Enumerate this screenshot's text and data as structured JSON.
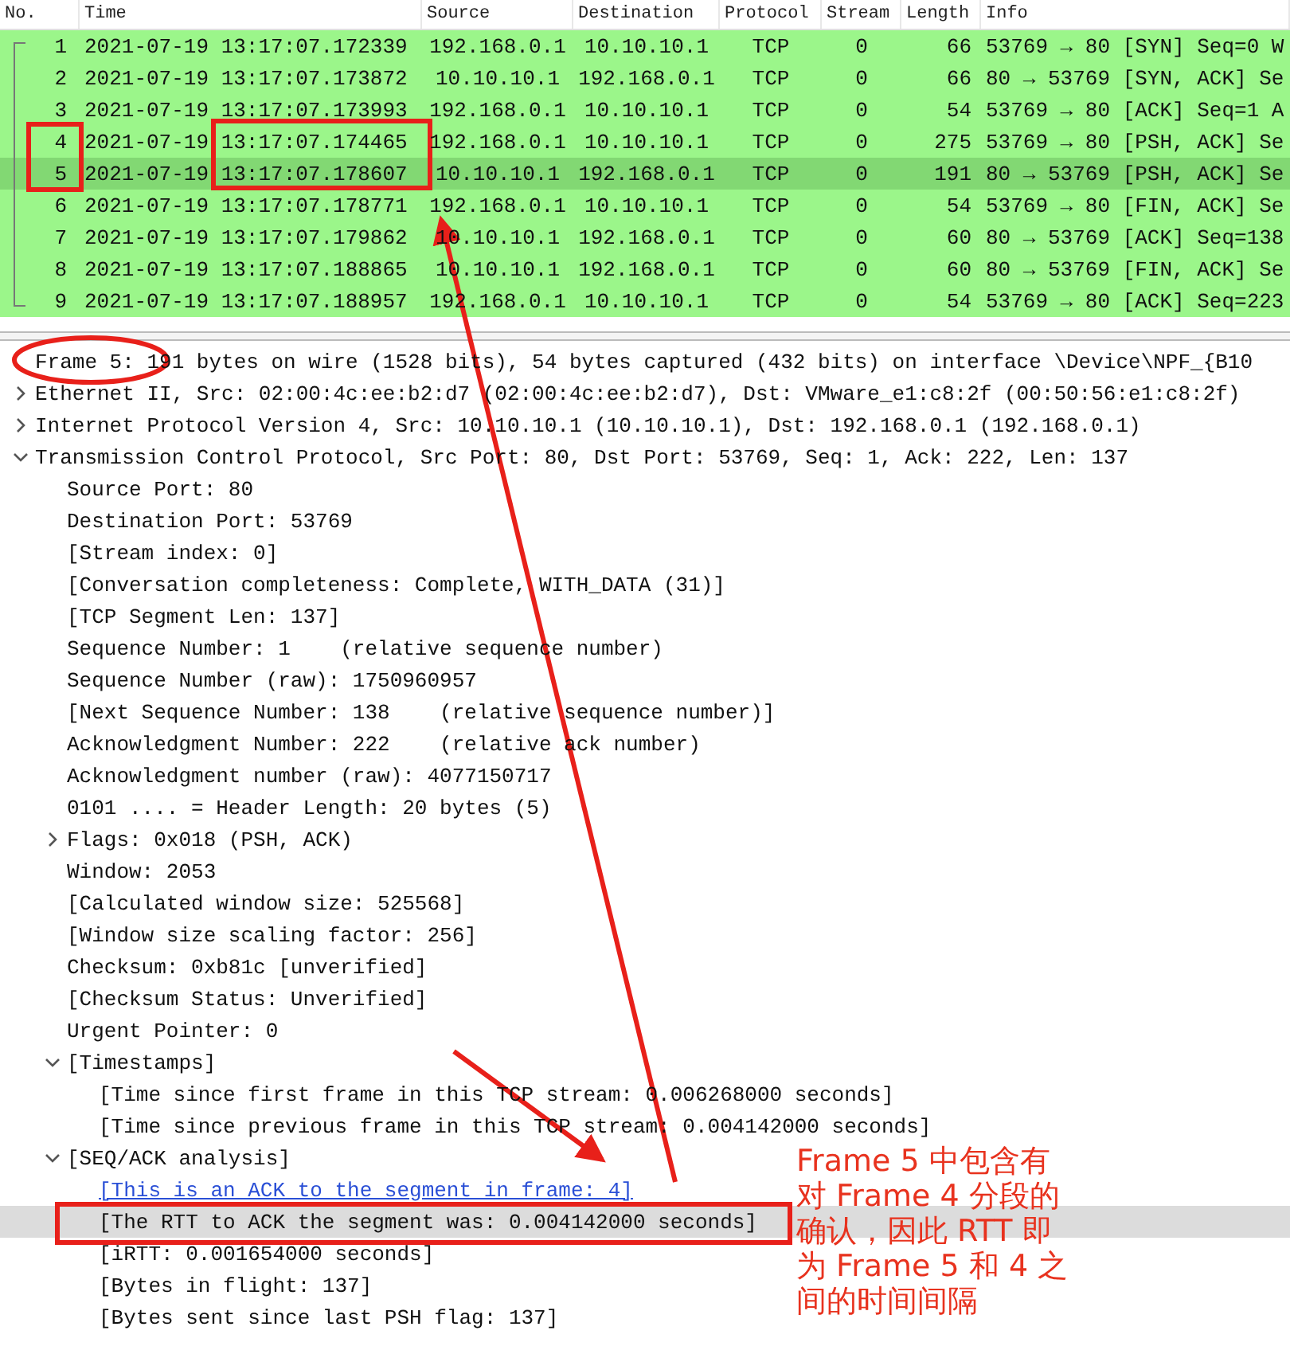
{
  "packet_list": {
    "columns": [
      "No.",
      "Time",
      "Source",
      "Destination",
      "Protocol",
      "Stream",
      "Length",
      "Info"
    ],
    "rows": [
      {
        "cells": [
          "1",
          "2021-07-19 13:17:07.172339",
          "192.168.0.1",
          "10.10.10.1",
          "TCP",
          "0",
          "66",
          "53769 → 80 [SYN] Seq=0 W"
        ],
        "selected": false
      },
      {
        "cells": [
          "2",
          "2021-07-19 13:17:07.173872",
          "10.10.10.1",
          "192.168.0.1",
          "TCP",
          "0",
          "66",
          "80 → 53769 [SYN, ACK] Se"
        ],
        "selected": false
      },
      {
        "cells": [
          "3",
          "2021-07-19 13:17:07.173993",
          "192.168.0.1",
          "10.10.10.1",
          "TCP",
          "0",
          "54",
          "53769 → 80 [ACK] Seq=1 A"
        ],
        "selected": false
      },
      {
        "cells": [
          "4",
          "2021-07-19 13:17:07.174465",
          "192.168.0.1",
          "10.10.10.1",
          "TCP",
          "0",
          "275",
          "53769 → 80 [PSH, ACK] Se"
        ],
        "selected": false
      },
      {
        "cells": [
          "5",
          "2021-07-19 13:17:07.178607",
          "10.10.10.1",
          "192.168.0.1",
          "TCP",
          "0",
          "191",
          "80 → 53769 [PSH, ACK] Se"
        ],
        "selected": true
      },
      {
        "cells": [
          "6",
          "2021-07-19 13:17:07.178771",
          "192.168.0.1",
          "10.10.10.1",
          "TCP",
          "0",
          "54",
          "53769 → 80 [FIN, ACK] Se"
        ],
        "selected": false
      },
      {
        "cells": [
          "7",
          "2021-07-19 13:17:07.179862",
          "10.10.10.1",
          "192.168.0.1",
          "TCP",
          "0",
          "60",
          "80 → 53769 [ACK] Seq=138"
        ],
        "selected": false
      },
      {
        "cells": [
          "8",
          "2021-07-19 13:17:07.188865",
          "10.10.10.1",
          "192.168.0.1",
          "TCP",
          "0",
          "60",
          "80 → 53769 [FIN, ACK] Se"
        ],
        "selected": false
      },
      {
        "cells": [
          "9",
          "2021-07-19 13:17:07.188957",
          "192.168.0.1",
          "10.10.10.1",
          "TCP",
          "0",
          "54",
          "53769 → 80 [ACK] Seq=223"
        ],
        "selected": false
      }
    ]
  },
  "details": [
    {
      "text": "Frame 5: 191 bytes on wire (1528 bits), 54 bytes captured (432 bits) on interface \\Device\\NPF_{B10",
      "selected": false
    },
    {
      "text": "Ethernet II, Src: 02:00:4c:ee:b2:d7 (02:00:4c:ee:b2:d7), Dst: VMware_e1:c8:2f (00:50:56:e1:c8:2f)",
      "expanded": false,
      "selected": false
    },
    {
      "text": "Internet Protocol Version 4, Src: 10.10.10.1 (10.10.10.1), Dst: 192.168.0.1 (192.168.0.1)",
      "expanded": false,
      "selected": false
    },
    {
      "text": "Transmission Control Protocol, Src Port: 80, Dst Port: 53769, Seq: 1, Ack: 222, Len: 137",
      "expanded": true,
      "selected": false,
      "children": [
        {
          "text": "Source Port: 80",
          "selected": false
        },
        {
          "text": "Destination Port: 53769",
          "selected": false
        },
        {
          "text": "[Stream index: 0]",
          "selected": false
        },
        {
          "text": "[Conversation completeness: Complete, WITH_DATA (31)]",
          "selected": false
        },
        {
          "text": "[TCP Segment Len: 137]",
          "selected": false
        },
        {
          "text": "Sequence Number: 1    (relative sequence number)",
          "selected": false
        },
        {
          "text": "Sequence Number (raw): 1750960957",
          "selected": false
        },
        {
          "text": "[Next Sequence Number: 138    (relative sequence number)]",
          "selected": false
        },
        {
          "text": "Acknowledgment Number: 222    (relative ack number)",
          "selected": false
        },
        {
          "text": "Acknowledgment number (raw): 4077150717",
          "selected": false
        },
        {
          "text": "0101 .... = Header Length: 20 bytes (5)",
          "selected": false
        },
        {
          "text": "Flags: 0x018 (PSH, ACK)",
          "expanded": false,
          "selected": false
        },
        {
          "text": "Window: 2053",
          "selected": false
        },
        {
          "text": "[Calculated window size: 525568]",
          "selected": false
        },
        {
          "text": "[Window size scaling factor: 256]",
          "selected": false
        },
        {
          "text": "Checksum: 0xb81c [unverified]",
          "selected": false
        },
        {
          "text": "[Checksum Status: Unverified]",
          "selected": false
        },
        {
          "text": "Urgent Pointer: 0",
          "selected": false
        },
        {
          "text": "[Timestamps]",
          "expanded": true,
          "selected": false,
          "children": [
            {
              "text": "[Time since first frame in this TCP stream: 0.006268000 seconds]",
              "selected": false
            },
            {
              "text": "[Time since previous frame in this TCP stream: 0.004142000 seconds]",
              "selected": false
            }
          ]
        },
        {
          "text": "[SEQ/ACK analysis]",
          "expanded": true,
          "selected": false,
          "children": [
            {
              "text": "[This is an ACK to the segment in frame: 4]",
              "kind": "link",
              "selected": false
            },
            {
              "text": "[The RTT to ACK the segment was: 0.004142000 seconds]",
              "selected": true
            },
            {
              "text": "[iRTT: 0.001654000 seconds]",
              "selected": false
            },
            {
              "text": "[Bytes in flight: 137]",
              "selected": false
            },
            {
              "text": "[Bytes sent since last PSH flag: 137]",
              "selected": false
            }
          ]
        }
      ]
    }
  ],
  "annotation": {
    "lines": [
      "Frame 5 中包含有",
      "对 Frame 4 分段的",
      "确认，因此 RTT 即",
      "为 Frame 5 和 4 之",
      "间的时间间隔"
    ]
  }
}
